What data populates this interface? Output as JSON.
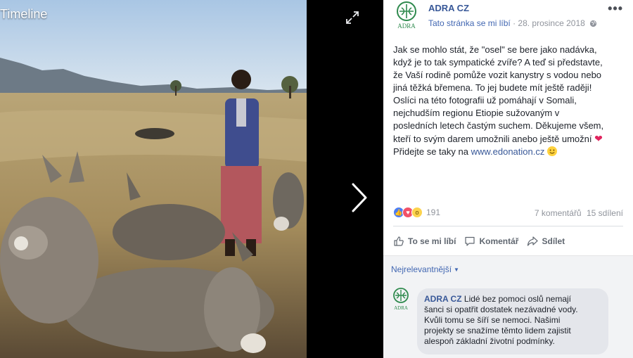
{
  "viewer": {
    "title": "Timeline",
    "expand_icon": "expand-icon",
    "next_icon": "chevron-right-icon"
  },
  "post": {
    "page_name": "ADRA CZ",
    "like_page": "Tato stránka se mi líbí",
    "date": "28. prosince 2018",
    "more_icon": "more-icon",
    "text_lines": [
      "Jak se mohlo stát, že \"osel\" se bere jako nadávka,",
      "když je to tak sympatické zvíře? A teď si představte,",
      "že Vaší rodině pomůže vozit kanystry s vodou nebo",
      "jiná těžká břemena. To jej budete mít ještě raději!",
      "Oslíci na této fotografii už pomáhají v Somali,",
      "nejchudším regionu Etiopie sužovaným v",
      "posledních letech častým suchem. Děkujeme všem,",
      "kteří to svým darem umožnili anebo ještě umožní",
      "Přidejte se taky na"
    ],
    "link": "www.edonation.cz",
    "reaction_count": "191",
    "comments_count": "7 komentářů",
    "shares_count": "15 sdílení",
    "actions": {
      "like": "To se mi líbí",
      "comment": "Komentář",
      "share": "Sdílet"
    },
    "sort_label": "Nejrelevantnější",
    "comment": {
      "author": "ADRA CZ",
      "lines": [
        "Lidé bez pomoci oslů nemají",
        "šanci si opatřit dostatek nezávadné vody.",
        "Kvůli tomu se šíří se nemoci. Našimi",
        "projekty se snažíme těmto lidem zajistit",
        "alespoň základní životní podmínky."
      ]
    },
    "colors": {
      "link": "#385898",
      "accent": "#4267b2",
      "muted": "#90949c",
      "logo_green": "#2f8a4e"
    }
  }
}
